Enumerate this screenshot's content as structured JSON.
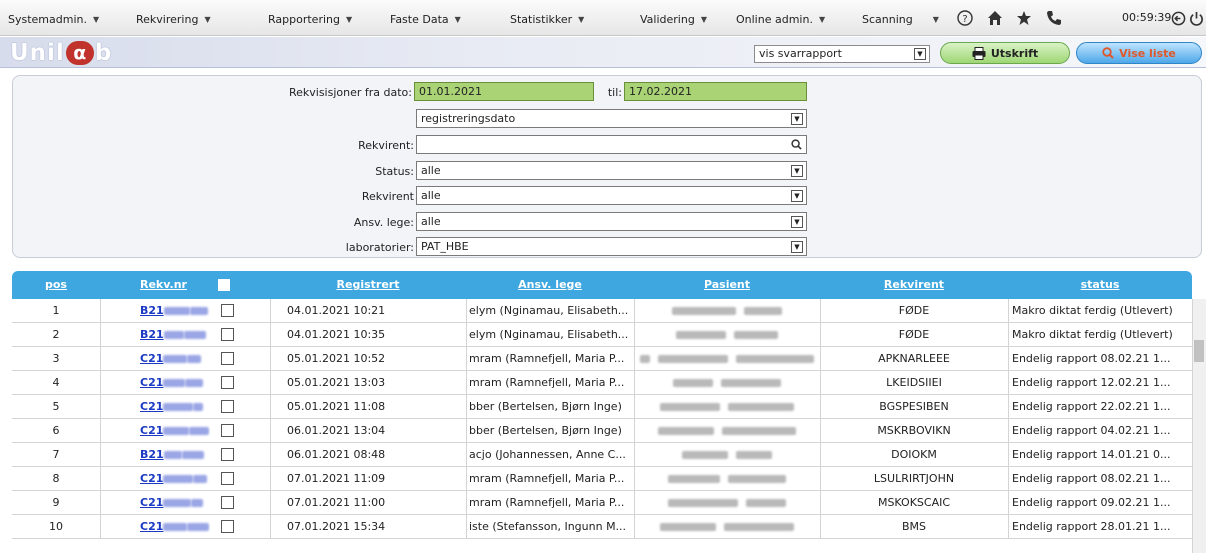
{
  "menu": [
    {
      "label": "Systemadmin."
    },
    {
      "label": "Rekvirering"
    },
    {
      "label": "Rapportering"
    },
    {
      "label": "Faste Data"
    },
    {
      "label": "Statistikker"
    },
    {
      "label": "Validering"
    },
    {
      "label": "Online admin."
    },
    {
      "label": "Scanning"
    }
  ],
  "toolbar": {
    "help_icon": "?",
    "home_icon": "home",
    "favorite_icon": "star",
    "phone_icon": "phone",
    "clock": "00:59:39",
    "logout_icon": "power"
  },
  "brand": {
    "part1": "Unil",
    "part2": "b"
  },
  "report_select": {
    "value": "vis svarrapport"
  },
  "buttons": {
    "utskrift": "Utskrift",
    "vise": "Vise liste"
  },
  "filters": {
    "date_from_label": "Rekvisisjoner fra dato:",
    "date_from": "01.01.2021",
    "date_to_label": "til:",
    "date_to": "17.02.2021",
    "date_type": "registreringsdato",
    "rekvirent_search_label": "Rekvirent:",
    "rekvirent_search": "",
    "status_label": "Status:",
    "status": "alle",
    "rekvirent_label": "Rekvirent",
    "rekvirent": "alle",
    "ansv_label": "Ansv. lege:",
    "ansv": "alle",
    "lab_label": "laboratorier:",
    "lab": "PAT_HBE"
  },
  "table": {
    "headers": {
      "pos": "pos",
      "rekvnr": "Rekv.nr",
      "registrert": "Registrert",
      "ansv": "Ansv. lege",
      "pasient": "Pasient",
      "rekvirent": "Rekvirent",
      "status": "status"
    },
    "rows": [
      {
        "pos": "1",
        "rekvnr": "B21",
        "registrert": "04.01.2021   10:21",
        "ansv": "elym (Nginamau, Elisabeth...",
        "rekvirent": "FØDE",
        "status": "Makro diktat ferdig (Utlevert)"
      },
      {
        "pos": "2",
        "rekvnr": "B21",
        "registrert": "04.01.2021   10:35",
        "ansv": "elym (Nginamau, Elisabeth...",
        "rekvirent": "FØDE",
        "status": "Makro diktat ferdig (Utlevert)"
      },
      {
        "pos": "3",
        "rekvnr": "C21",
        "registrert": "05.01.2021   10:52",
        "ansv": "mram (Ramnefjell, Maria P...",
        "rekvirent": "APKNARLEEE",
        "status": "Endelig rapport 08.02.21 1..."
      },
      {
        "pos": "4",
        "rekvnr": "C21",
        "registrert": "05.01.2021   13:03",
        "ansv": "mram (Ramnefjell, Maria P...",
        "rekvirent": "LKEIDSIIEI",
        "status": "Endelig rapport 12.02.21 1..."
      },
      {
        "pos": "5",
        "rekvnr": "C21",
        "registrert": "05.01.2021   11:08",
        "ansv": "bber (Bertelsen, Bjørn Inge)",
        "rekvirent": "BGSPESIBEN",
        "status": "Endelig rapport 22.02.21 1..."
      },
      {
        "pos": "6",
        "rekvnr": "C21",
        "registrert": "06.01.2021   13:04",
        "ansv": "bber (Bertelsen, Bjørn Inge)",
        "rekvirent": "MSKRBOVIKN",
        "status": "Endelig rapport 04.02.21 1..."
      },
      {
        "pos": "7",
        "rekvnr": "B21",
        "registrert": "06.01.2021   08:48",
        "ansv": "acjo (Johannessen, Anne C...",
        "rekvirent": "DOIOKM",
        "status": "Endelig rapport 14.01.21 0..."
      },
      {
        "pos": "8",
        "rekvnr": "C21",
        "registrert": "07.01.2021   11:09",
        "ansv": "mram (Ramnefjell, Maria P...",
        "rekvirent": "LSULRIRTJOHN",
        "status": "Endelig rapport 08.02.21 1..."
      },
      {
        "pos": "9",
        "rekvnr": "C21",
        "registrert": "07.01.2021   11:00",
        "ansv": "mram (Ramnefjell, Maria P...",
        "rekvirent": "MSKOKSCAIC",
        "status": "Endelig rapport 09.02.21 1..."
      },
      {
        "pos": "10",
        "rekvnr": "C21",
        "registrert": "07.01.2021   15:34",
        "ansv": "iste (Stefansson, Ingunn M...",
        "rekvirent": "BMS",
        "status": "Endelig rapport 28.01.21 1..."
      }
    ]
  },
  "colors": {
    "header_blue": "#3fa7e0",
    "date_green": "#aad375",
    "link_blue": "#1a39c4",
    "logo_red": "#c0322b"
  }
}
